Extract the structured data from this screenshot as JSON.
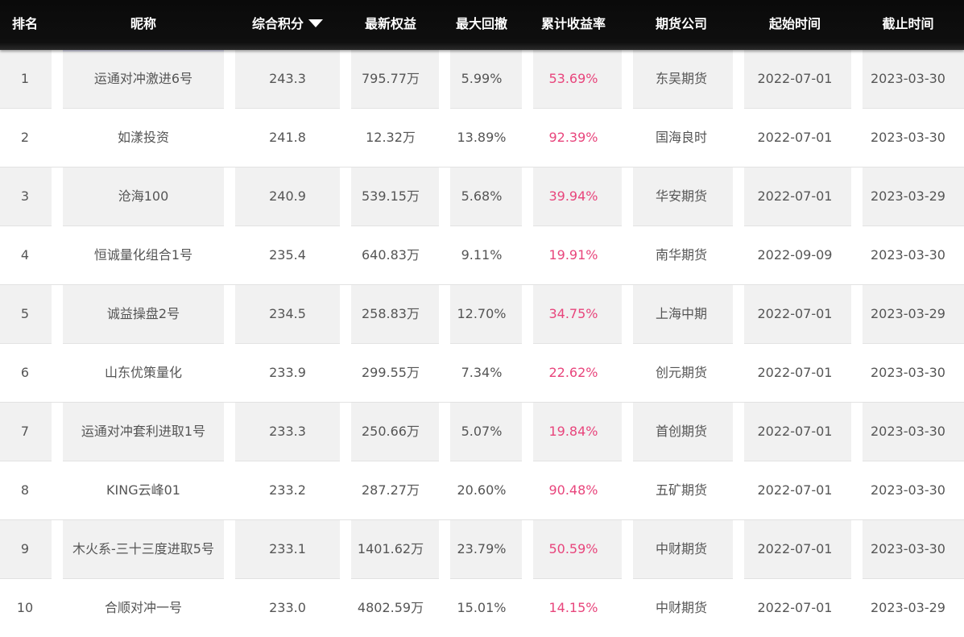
{
  "headers": {
    "rank": "排名",
    "nickname": "昵称",
    "score": "综合积分",
    "equity": "最新权益",
    "drawdown": "最大回撤",
    "return": "累计收益率",
    "company": "期货公司",
    "start": "起始时间",
    "end": "截止时间"
  },
  "sort_icon": "sort-desc-icon",
  "colors": {
    "header_bg": "#0f0f0f",
    "odd_row_bg": "#f1f1f1",
    "return_text": "#e8457c",
    "cell_text": "#555555"
  },
  "rows": [
    {
      "rank": "1",
      "nickname": "运通对冲激进6号",
      "score": "243.3",
      "equity": "795.77万",
      "drawdown": "5.99%",
      "return": "53.69%",
      "company": "东吴期货",
      "start": "2022-07-01",
      "end": "2023-03-30"
    },
    {
      "rank": "2",
      "nickname": "如漾投资",
      "score": "241.8",
      "equity": "12.32万",
      "drawdown": "13.89%",
      "return": "92.39%",
      "company": "国海良时",
      "start": "2022-07-01",
      "end": "2023-03-30"
    },
    {
      "rank": "3",
      "nickname": "沧海100",
      "score": "240.9",
      "equity": "539.15万",
      "drawdown": "5.68%",
      "return": "39.94%",
      "company": "华安期货",
      "start": "2022-07-01",
      "end": "2023-03-29"
    },
    {
      "rank": "4",
      "nickname": "恒诚量化组合1号",
      "score": "235.4",
      "equity": "640.83万",
      "drawdown": "9.11%",
      "return": "19.91%",
      "company": "南华期货",
      "start": "2022-09-09",
      "end": "2023-03-30"
    },
    {
      "rank": "5",
      "nickname": "诚益操盘2号",
      "score": "234.5",
      "equity": "258.83万",
      "drawdown": "12.70%",
      "return": "34.75%",
      "company": "上海中期",
      "start": "2022-07-01",
      "end": "2023-03-29"
    },
    {
      "rank": "6",
      "nickname": "山东优策量化",
      "score": "233.9",
      "equity": "299.55万",
      "drawdown": "7.34%",
      "return": "22.62%",
      "company": "创元期货",
      "start": "2022-07-01",
      "end": "2023-03-30"
    },
    {
      "rank": "7",
      "nickname": "运通对冲套利进取1号",
      "score": "233.3",
      "equity": "250.66万",
      "drawdown": "5.07%",
      "return": "19.84%",
      "company": "首创期货",
      "start": "2022-07-01",
      "end": "2023-03-30"
    },
    {
      "rank": "8",
      "nickname": "KING云峰01",
      "score": "233.2",
      "equity": "287.27万",
      "drawdown": "20.60%",
      "return": "90.48%",
      "company": "五矿期货",
      "start": "2022-07-01",
      "end": "2023-03-30"
    },
    {
      "rank": "9",
      "nickname": "木火系-三十三度进取5号",
      "score": "233.1",
      "equity": "1401.62万",
      "drawdown": "23.79%",
      "return": "50.59%",
      "company": "中财期货",
      "start": "2022-07-01",
      "end": "2023-03-30"
    },
    {
      "rank": "10",
      "nickname": "合顺对冲一号",
      "score": "233.0",
      "equity": "4802.59万",
      "drawdown": "15.01%",
      "return": "14.15%",
      "company": "中财期货",
      "start": "2022-07-01",
      "end": "2023-03-29"
    }
  ]
}
